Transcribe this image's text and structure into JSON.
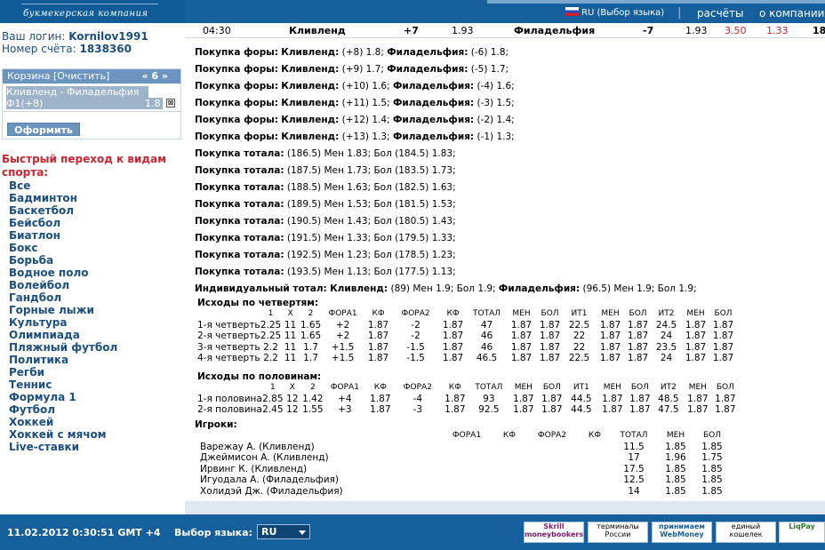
{
  "header": {
    "logo_text": "букмекерская компания",
    "language": "RU (Выбор языка)",
    "separator": "|",
    "nav": [
      "расчёты",
      "о компании"
    ]
  },
  "sidebar": {
    "login_label": "Ваш логин:",
    "login_value": "Kornilov1991",
    "account_label": "Номер счёта:",
    "account_value": "1838360",
    "basket": {
      "title": "Корзина [Очистить]",
      "count": "« 6 »",
      "item_line1": "Кливленд - Филадельфия",
      "item_line2": "Ф1(+8)",
      "odd": "1.8",
      "remove": "⊠",
      "submit": "Оформить"
    },
    "quick_title": "Быстрый переход к видам спорта:",
    "sports": [
      "Все",
      "Бадминтон",
      "Баскетбол",
      "Бейсбол",
      "Биатлон",
      "Бокс",
      "Борьба",
      "Водное поло",
      "Волейбол",
      "Гандбол",
      "Горные лыжи",
      "Культура",
      "Олимпиада",
      "Пляжный футбол",
      "Политика",
      "Регби",
      "Теннис",
      "Формула 1",
      "Футбол",
      "Хоккей",
      "Хоккей с мячом",
      "Live-ставки"
    ]
  },
  "match": {
    "time": "04:30",
    "team1": "Кливленд",
    "hcp1": "+7",
    "odd1": "1.93",
    "team2": "Филадельфия",
    "hcp2": "-7",
    "odd2": "1.93",
    "c1": "3.50",
    "c2": "1.33",
    "c3": "18"
  },
  "lines": [
    {
      "label": "Покупка форы:",
      "a": "Кливленд:",
      "av": "(+8) 1.8;",
      "b": "Филадельфия:",
      "bv": "(-6) 1.8;"
    },
    {
      "label": "Покупка форы:",
      "a": "Кливленд:",
      "av": "(+9) 1.7;",
      "b": "Филадельфия:",
      "bv": "(-5) 1.7;"
    },
    {
      "label": "Покупка форы:",
      "a": "Кливленд:",
      "av": "(+10) 1.6;",
      "b": "Филадельфия:",
      "bv": "(-4) 1.6;"
    },
    {
      "label": "Покупка форы:",
      "a": "Кливленд:",
      "av": "(+11) 1.5;",
      "b": "Филадельфия:",
      "bv": "(-3) 1.5;"
    },
    {
      "label": "Покупка форы:",
      "a": "Кливленд:",
      "av": "(+12) 1.4;",
      "b": "Филадельфия:",
      "bv": "(-2) 1.4;"
    },
    {
      "label": "Покупка форы:",
      "a": "Кливленд:",
      "av": "(+13) 1.3;",
      "b": "Филадельфия:",
      "bv": "(-1) 1.3;"
    },
    {
      "label": "Покупка тотала:",
      "a": "",
      "av": "(186.5) Мен 1.83; Бол (184.5) 1.83;",
      "b": "",
      "bv": ""
    },
    {
      "label": "Покупка тотала:",
      "a": "",
      "av": "(187.5) Мен 1.73; Бол (183.5) 1.73;",
      "b": "",
      "bv": ""
    },
    {
      "label": "Покупка тотала:",
      "a": "",
      "av": "(188.5) Мен 1.63; Бол (182.5) 1.63;",
      "b": "",
      "bv": ""
    },
    {
      "label": "Покупка тотала:",
      "a": "",
      "av": "(189.5) Мен 1.53; Бол (181.5) 1.53;",
      "b": "",
      "bv": ""
    },
    {
      "label": "Покупка тотала:",
      "a": "",
      "av": "(190.5) Мен 1.43; Бол (180.5) 1.43;",
      "b": "",
      "bv": ""
    },
    {
      "label": "Покупка тотала:",
      "a": "",
      "av": "(191.5) Мен 1.33; Бол (179.5) 1.33;",
      "b": "",
      "bv": ""
    },
    {
      "label": "Покупка тотала:",
      "a": "",
      "av": "(192.5) Мен 1.23; Бол (178.5) 1.23;",
      "b": "",
      "bv": ""
    },
    {
      "label": "Покупка тотала:",
      "a": "",
      "av": "(193.5) Мен 1.13; Бол (177.5) 1.13;",
      "b": "",
      "bv": ""
    },
    {
      "label": "Индивидуальный тотал:",
      "a": "Кливленд:",
      "av": "(89) Мен 1.9; Бол 1.9;",
      "b": "Филадельфия:",
      "bv": "(96.5) Мен 1.9; Бол 1.9;"
    }
  ],
  "quarters": {
    "title": "Исходы по четвертям:",
    "headers": [
      "",
      "1",
      "X",
      "2",
      "ФОРА1",
      "КФ",
      "ФОРА2",
      "КФ",
      "ТОТАЛ",
      "МЕН",
      "БОЛ",
      "ИТ1",
      "МЕН",
      "БОЛ",
      "ИТ2",
      "МЕН",
      "БОЛ"
    ],
    "rows": [
      [
        "1-я четверть",
        "2.25",
        "11",
        "1.65",
        "+2",
        "1.87",
        "-2",
        "1.87",
        "47",
        "1.87",
        "1.87",
        "22.5",
        "1.87",
        "1.87",
        "24.5",
        "1.87",
        "1.87"
      ],
      [
        "2-я четверть",
        "2.25",
        "11",
        "1.65",
        "+2",
        "1.87",
        "-2",
        "1.87",
        "46",
        "1.87",
        "1.87",
        "22",
        "1.87",
        "1.87",
        "24",
        "1.87",
        "1.87"
      ],
      [
        "3-я четверть",
        "2.2",
        "11",
        "1.7",
        "+1.5",
        "1.87",
        "-1.5",
        "1.87",
        "46",
        "1.87",
        "1.87",
        "22",
        "1.87",
        "1.87",
        "23.5",
        "1.87",
        "1.87"
      ],
      [
        "4-я четверть",
        "2.2",
        "11",
        "1.7",
        "+1.5",
        "1.87",
        "-1.5",
        "1.87",
        "46.5",
        "1.87",
        "1.87",
        "22.5",
        "1.87",
        "1.87",
        "24",
        "1.87",
        "1.87"
      ]
    ]
  },
  "halves": {
    "title": "Исходы по половинам:",
    "headers": [
      "",
      "1",
      "X",
      "2",
      "ФОРА1",
      "КФ",
      "ФОРА2",
      "КФ",
      "ТОТАЛ",
      "МЕН",
      "БОЛ",
      "ИТ1",
      "МЕН",
      "БОЛ",
      "ИТ2",
      "МЕН",
      "БОЛ"
    ],
    "rows": [
      [
        "1-я половина",
        "2.85",
        "12",
        "1.42",
        "+4",
        "1.87",
        "-4",
        "1.87",
        "93",
        "1.87",
        "1.87",
        "44.5",
        "1.87",
        "1.87",
        "48.5",
        "1.87",
        "1.87"
      ],
      [
        "2-я половина",
        "2.45",
        "12",
        "1.55",
        "+3",
        "1.87",
        "-3",
        "1.87",
        "92.5",
        "1.87",
        "1.87",
        "44.5",
        "1.87",
        "1.87",
        "47.5",
        "1.87",
        "1.87"
      ]
    ]
  },
  "players": {
    "title": "Игроки:",
    "headers": [
      "",
      "ФОРА1",
      "КФ",
      "ФОРА2",
      "КФ",
      "ТОТАЛ",
      "МЕН",
      "БОЛ"
    ],
    "rows": [
      [
        "Варежау А. (Кливленд)",
        "",
        "",
        "",
        "",
        "11.5",
        "1.85",
        "1.85"
      ],
      [
        "Джеймисон А. (Кливленд)",
        "",
        "",
        "",
        "",
        "17",
        "1.96",
        "1.75"
      ],
      [
        "Ирвинг К. (Кливленд)",
        "",
        "",
        "",
        "",
        "17.5",
        "1.85",
        "1.85"
      ],
      [
        "Игуодала А. (Филадельфия)",
        "",
        "",
        "",
        "",
        "12.5",
        "1.85",
        "1.85"
      ],
      [
        "Холидэй Дж. (Филадельфия)",
        "",
        "",
        "",
        "",
        "14",
        "1.85",
        "1.85"
      ]
    ]
  },
  "footer": {
    "datetime": "11.02.2012  0:30:51  GMT +4",
    "lang_label": "Выбор языка:",
    "lang_value": "RU",
    "payments": [
      "Skrill moneybookers",
      "терминалы России",
      "принимаем WebMoney",
      "единый кошелек",
      "LiqPay"
    ]
  },
  "colors": {
    "brand": "#165f9d",
    "link": "#1b4f82",
    "accent_red": "#c8262e"
  }
}
